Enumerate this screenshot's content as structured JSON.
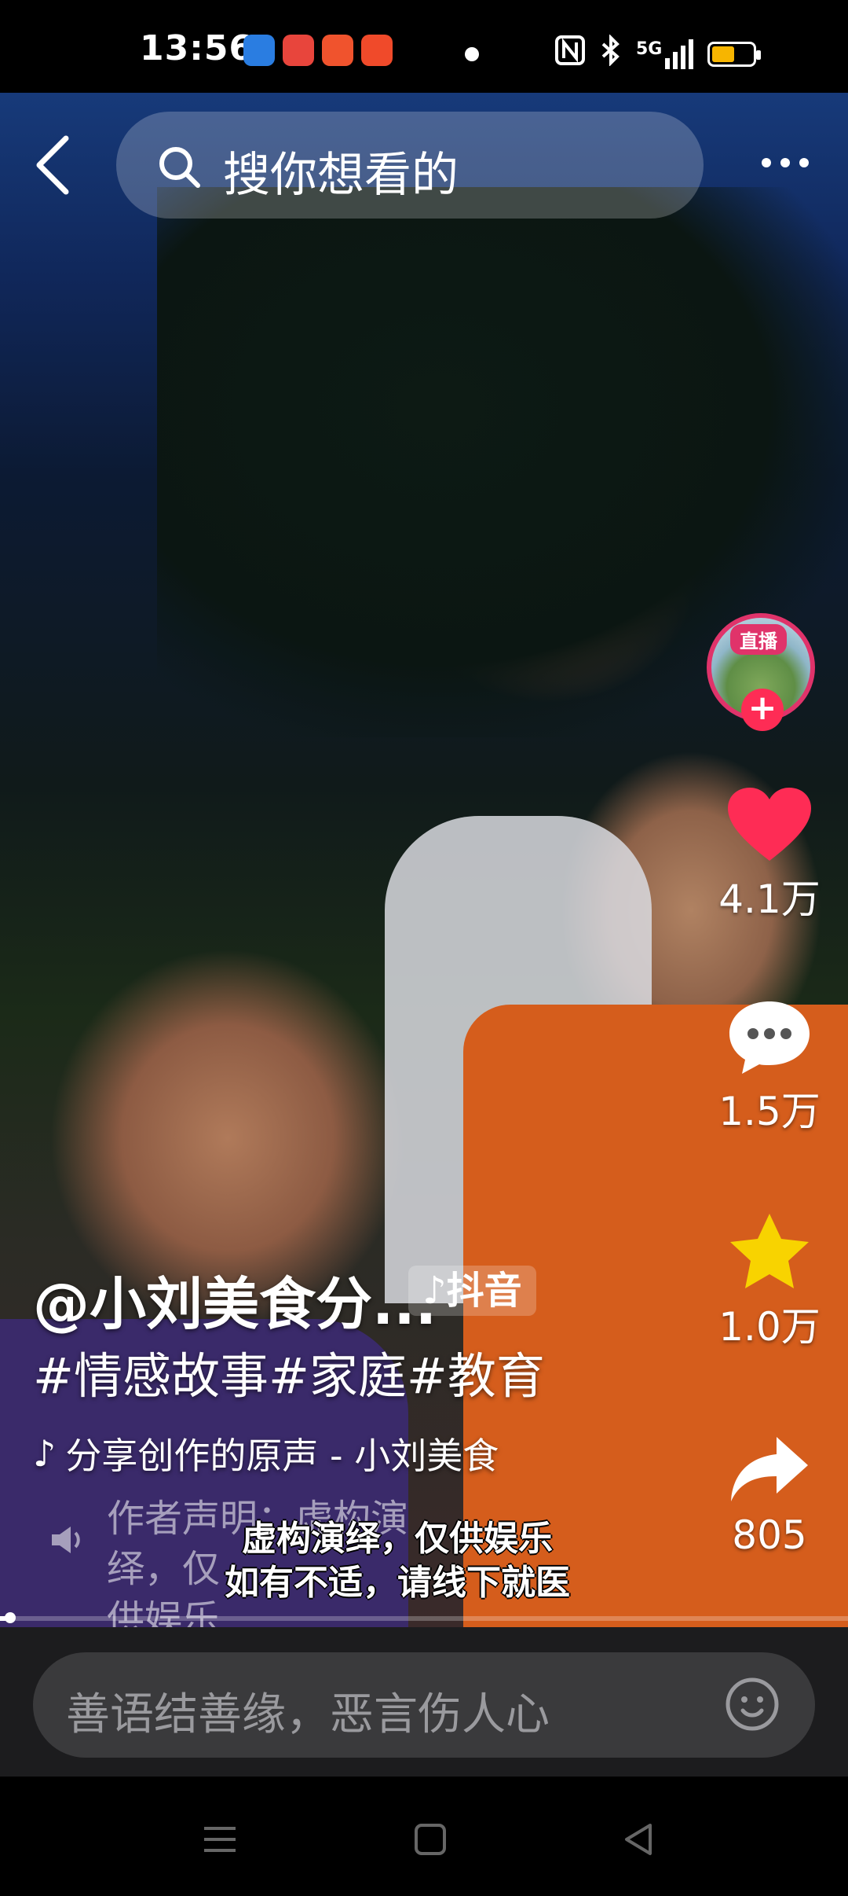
{
  "status_bar": {
    "time": "13:56",
    "network": "5G",
    "battery_level": 0.55,
    "battery_color": "#f7b500"
  },
  "top_bar": {
    "search_placeholder": "搜你想看的"
  },
  "side_rail": {
    "live_badge": "直播",
    "follow_symbol": "+",
    "likes": "4.1万",
    "comments": "1.5万",
    "favorites": "1.0万",
    "shares": "805",
    "like_color": "#fe2c55",
    "favorite_color": "#f8d300"
  },
  "video_info": {
    "author": "@小刘美食分...",
    "platform_tag": "抖音",
    "hashtags": "#情感故事#家庭#教育",
    "music": "分享创作的原声 - 小刘美食",
    "declaration_line1": "作者声明：虚构演绎，仅",
    "declaration_line2": "供娱乐",
    "subtitle_line1": "虚构演绎，仅供娱乐",
    "subtitle_line2": "如有不适，请线下就医",
    "progress": 0.01
  },
  "comment_bar": {
    "placeholder": "善语结善缘，恶言伤人心"
  },
  "nav_bar": {
    "items": [
      "menu-icon",
      "home-square-icon",
      "back-triangle-icon"
    ]
  }
}
